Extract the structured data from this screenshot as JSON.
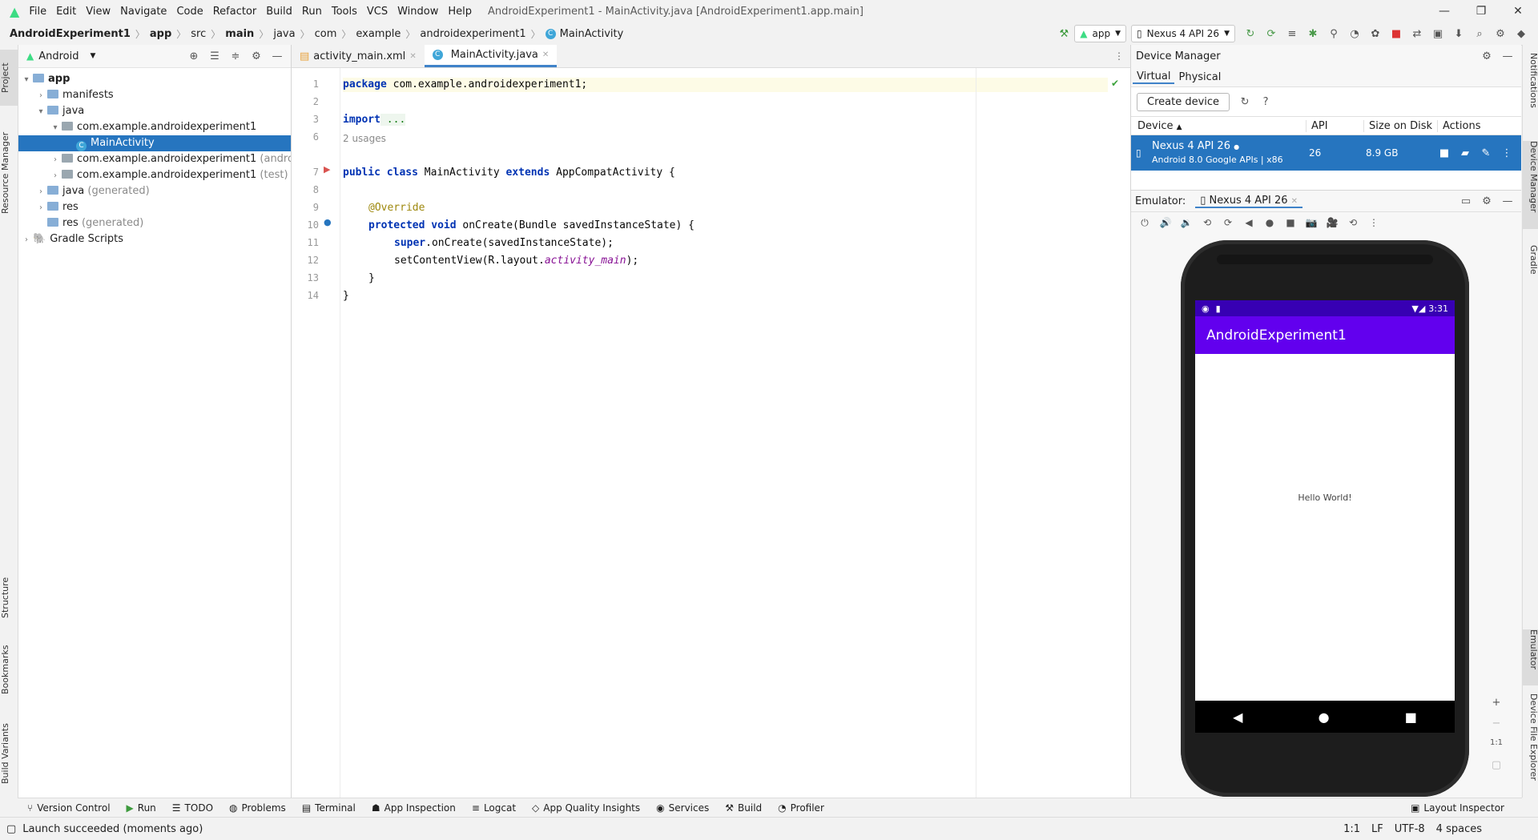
{
  "menu": {
    "items": [
      "File",
      "Edit",
      "View",
      "Navigate",
      "Code",
      "Refactor",
      "Build",
      "Run",
      "Tools",
      "VCS",
      "Window",
      "Help"
    ],
    "window_title": "AndroidExperiment1 - MainActivity.java [AndroidExperiment1.app.main]"
  },
  "breadcrumb": [
    "AndroidExperiment1",
    "app",
    "src",
    "main",
    "java",
    "com",
    "example",
    "androidexperiment1",
    "MainActivity"
  ],
  "toolbar": {
    "run_config": "app",
    "device": "Nexus 4 API 26"
  },
  "left_stripe": {
    "project": "Project",
    "resource_manager": "Resource Manager",
    "structure": "Structure",
    "bookmarks": "Bookmarks",
    "build_variants": "Build Variants"
  },
  "right_stripe": {
    "notifications": "Notifications",
    "device_manager": "Device Manager",
    "gradle": "Gradle",
    "emulator": "Emulator",
    "device_file_explorer": "Device File Explorer"
  },
  "project": {
    "view_mode": "Android",
    "tree": [
      {
        "label": "app",
        "suffix": ""
      },
      {
        "label": "manifests",
        "suffix": ""
      },
      {
        "label": "java",
        "suffix": ""
      },
      {
        "label": "com.example.androidexperiment1",
        "suffix": ""
      },
      {
        "label": "MainActivity",
        "suffix": ""
      },
      {
        "label": "com.example.androidexperiment1",
        "suffix": "(androidTe"
      },
      {
        "label": "com.example.androidexperiment1",
        "suffix": "(test)"
      },
      {
        "label": "java",
        "suffix": "(generated)"
      },
      {
        "label": "res",
        "suffix": ""
      },
      {
        "label": "res",
        "suffix": "(generated)"
      },
      {
        "label": "Gradle Scripts",
        "suffix": ""
      }
    ]
  },
  "editor": {
    "tabs": [
      "activity_main.xml",
      "MainActivity.java"
    ],
    "line_numbers": [
      "1",
      "2",
      "3",
      "6",
      "7",
      "8",
      "9",
      "10",
      "11",
      "12",
      "13",
      "14"
    ],
    "usages_hint": "2 usages",
    "code": {
      "l1_kw": "package",
      "l1_rest": " com.example.androidexperiment1;",
      "l3_kw": "import",
      "l3_rest": " ...",
      "l7_kw1": "public class",
      "l7_mid": " MainActivity ",
      "l7_kw2": "extends",
      "l7_rest": " AppCompatActivity {",
      "l9": "@Override",
      "l10_kw": "protected void",
      "l10_rest": " onCreate(Bundle savedInstanceState) {",
      "l11_kw": "super",
      "l11_rest": ".onCreate(savedInstanceState);",
      "l12_a": "setContentView(R.layout.",
      "l12_b": "activity_main",
      "l12_c": ");",
      "l13": "}",
      "l14": "}"
    }
  },
  "device_manager": {
    "title": "Device Manager",
    "tabs": [
      "Virtual",
      "Physical"
    ],
    "create_button": "Create device",
    "columns": [
      "Device",
      "API",
      "Size on Disk",
      "Actions"
    ],
    "device": {
      "name": "Nexus 4 API 26",
      "desc": "Android 8.0 Google APIs | x86",
      "api": "26",
      "size": "8.9 GB"
    }
  },
  "emulator": {
    "label": "Emulator:",
    "tab": "Nexus 4 API 26",
    "status_time": "3:31",
    "app_title": "AndroidExperiment1",
    "content_text": "Hello World!",
    "zoom_ratio": "1:1"
  },
  "bottom_tabs": [
    "Version Control",
    "Run",
    "TODO",
    "Problems",
    "Terminal",
    "App Inspection",
    "Logcat",
    "App Quality Insights",
    "Services",
    "Build",
    "Profiler"
  ],
  "layout_inspector": "Layout Inspector",
  "status": {
    "message": "Launch succeeded (moments ago)",
    "position": "1:1",
    "line_sep": "LF",
    "encoding": "UTF-8",
    "indent": "4 spaces"
  }
}
